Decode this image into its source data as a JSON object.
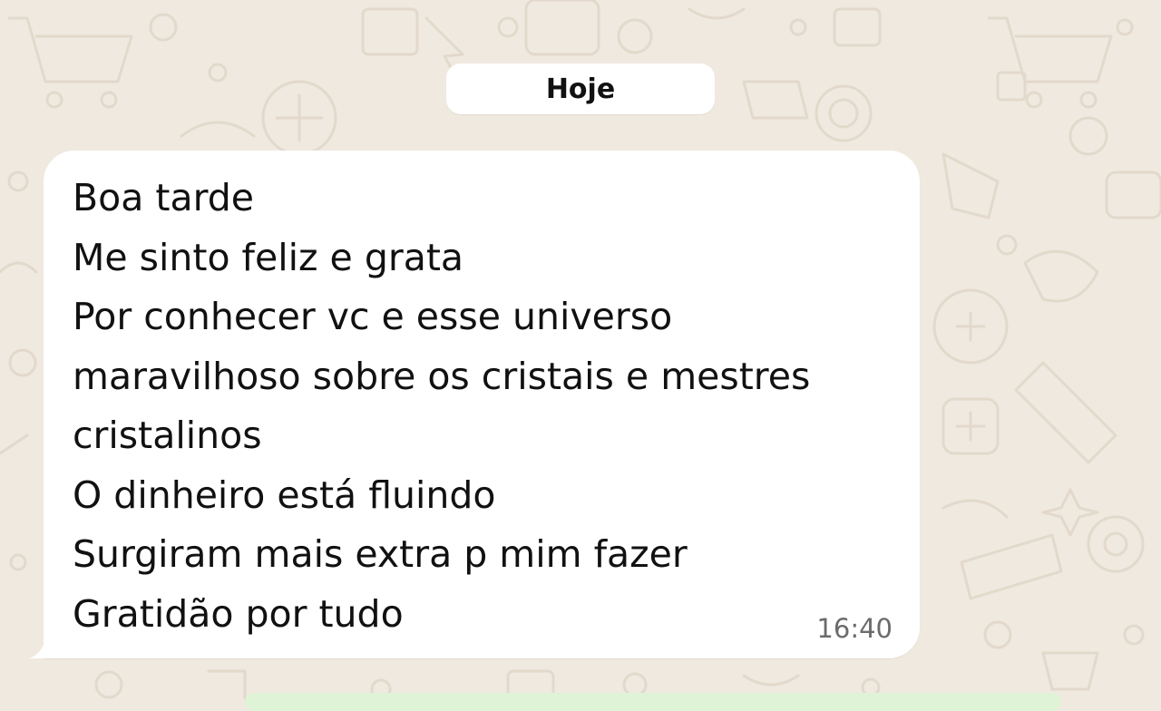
{
  "chat": {
    "date_label": "Hoje",
    "message": {
      "lines": [
        "Boa tarde",
        "Me sinto feliz e grata",
        "Por conhecer vc e esse universo",
        "maravilhoso sobre os cristais e mestres",
        "cristalinos",
        "O dinheiro está fluindo",
        "Surgiram mais extra p mim fazer",
        "Gratidão por tudo"
      ],
      "time": "16:40"
    }
  },
  "colors": {
    "wallpaper": "#efe9e0",
    "bubble": "#ffffff",
    "text": "#111111",
    "timestamp": "#6b6b6b"
  }
}
